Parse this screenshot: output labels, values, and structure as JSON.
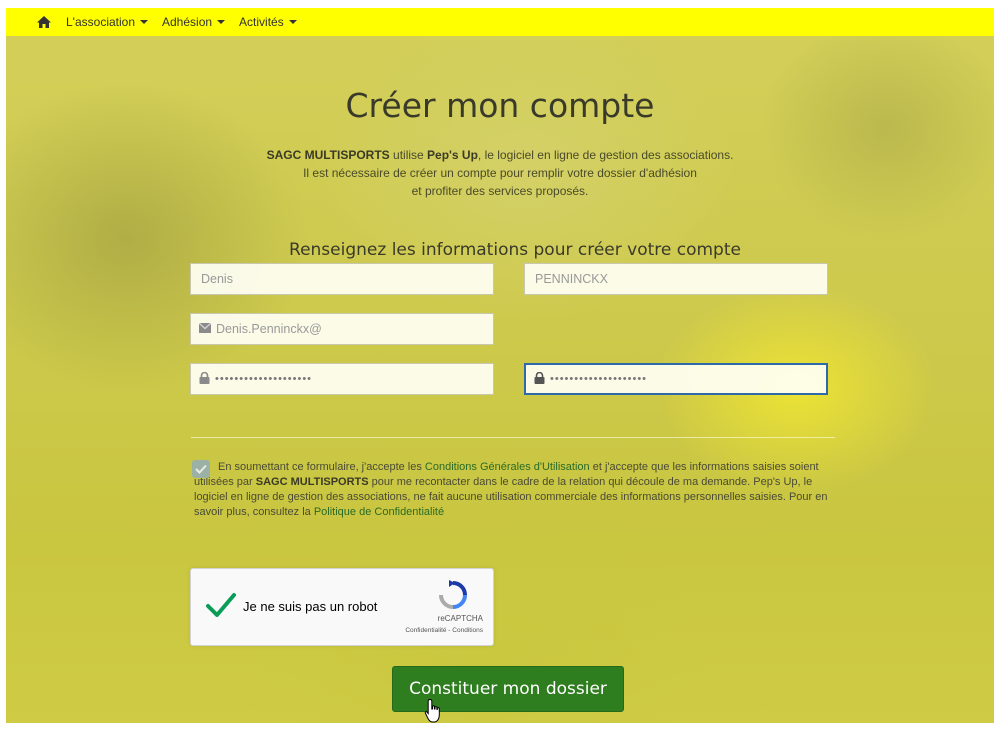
{
  "nav": {
    "home_icon": "home-icon",
    "items": [
      {
        "label": "L'association"
      },
      {
        "label": "Adhésion"
      },
      {
        "label": "Activités"
      }
    ]
  },
  "page": {
    "title": "Créer mon compte",
    "intro": {
      "org_name": "SAGC MULTISPORTS",
      "uses": " utilise ",
      "software_name": "Pep's Up",
      "line1_rest": ", le logiciel en ligne de gestion des associations.",
      "line2": "Il est nécessaire de créer un compte pour remplir votre dossier d'adhésion",
      "line3": "et profiter des services proposés."
    },
    "subtitle": "Renseignez les informations pour créer votre compte"
  },
  "form": {
    "first_name": "Denis",
    "last_name": "PENNINCKX",
    "email": "Denis.Penninckx@",
    "password_mask": "••••••••••••••••••••",
    "password_confirm_mask": "••••••••••••••••••••"
  },
  "consent": {
    "checked": true,
    "part1": "En soumettant ce formulaire, j'accepte les ",
    "cgu_link": "Conditions Générales d'Utilisation",
    "part2": " et j'accepte que les informations saisies soient utilisées par ",
    "org_name": "SAGC MULTISPORTS",
    "part3": " pour me recontacter dans le cadre de la relation qui découle de ma demande. Pep's Up, le logiciel en ligne de gestion des associations, ne fait aucune utilisation commerciale des informations personnelles saisies. Pour en savoir plus, consultez la ",
    "privacy_link": "Politique de Confidentialité"
  },
  "captcha": {
    "label": "Je ne suis pas un robot",
    "brand": "reCAPTCHA",
    "terms": "Confidentialité - Conditions",
    "checked": true
  },
  "submit_label": "Constituer mon dossier",
  "colors": {
    "navbar": "#ffff00",
    "submit": "#2e7d1e",
    "link": "#2b6b25",
    "focus_border": "#2f6aa8",
    "checkmark": "#0a9d58"
  }
}
